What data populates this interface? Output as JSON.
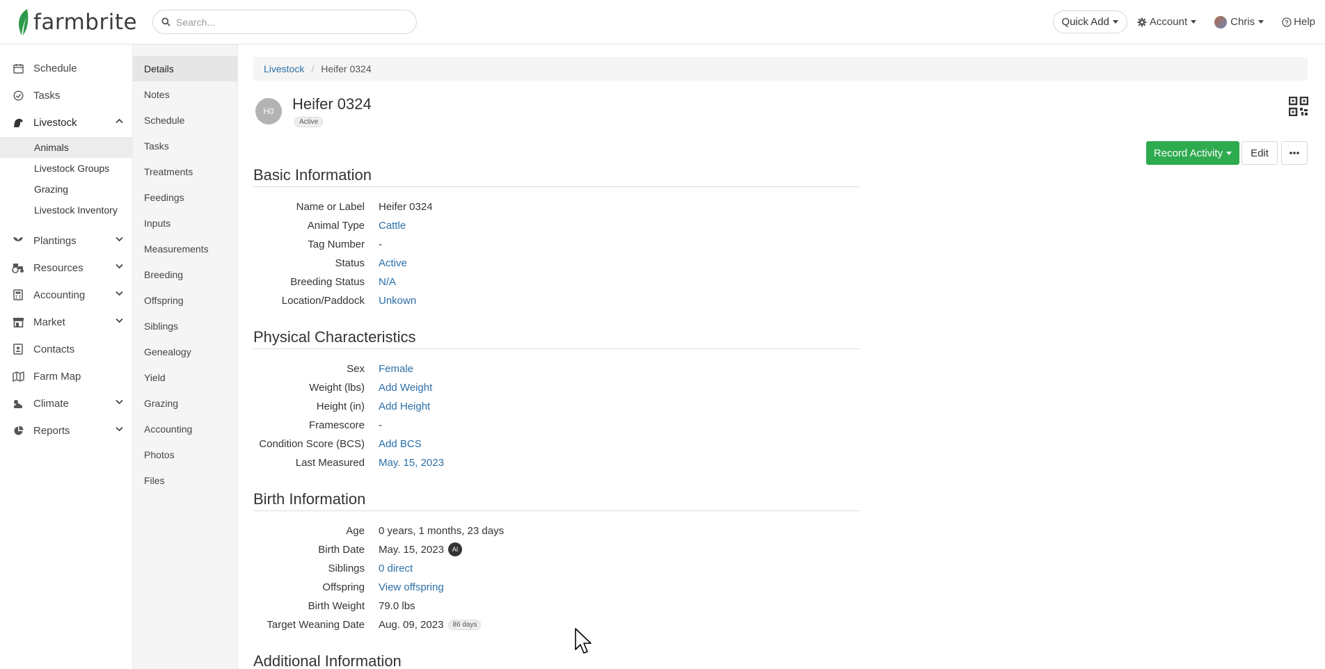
{
  "topbar": {
    "logo_text": "farmbrite",
    "search_placeholder": "Search...",
    "quick_add": "Quick Add",
    "account": "Account",
    "user": "Chris",
    "help": "Help"
  },
  "leftnav": {
    "items": [
      {
        "label": "Schedule",
        "icon": "calendar-icon"
      },
      {
        "label": "Tasks",
        "icon": "check-circle-icon"
      },
      {
        "label": "Livestock",
        "icon": "horse-icon"
      },
      {
        "label": "Plantings",
        "icon": "seedling-icon"
      },
      {
        "label": "Resources",
        "icon": "tractor-icon"
      },
      {
        "label": "Accounting",
        "icon": "calculator-icon"
      },
      {
        "label": "Market",
        "icon": "store-icon"
      },
      {
        "label": "Contacts",
        "icon": "contact-card-icon"
      },
      {
        "label": "Farm Map",
        "icon": "map-icon"
      },
      {
        "label": "Climate",
        "icon": "cloud-sun-icon"
      },
      {
        "label": "Reports",
        "icon": "pie-chart-icon"
      }
    ],
    "livestock_sub": [
      "Animals",
      "Livestock Groups",
      "Grazing",
      "Livestock Inventory"
    ]
  },
  "subnav": [
    "Details",
    "Notes",
    "Schedule",
    "Tasks",
    "Treatments",
    "Feedings",
    "Inputs",
    "Measurements",
    "Breeding",
    "Offspring",
    "Siblings",
    "Genealogy",
    "Yield",
    "Grazing",
    "Accounting",
    "Photos",
    "Files"
  ],
  "breadcrumb": {
    "parent": "Livestock",
    "current": "Heifer 0324"
  },
  "animal": {
    "initials": "H0",
    "name": "Heifer 0324",
    "status_badge": "Active"
  },
  "actions": {
    "record_activity": "Record Activity",
    "edit": "Edit"
  },
  "sections": {
    "basic": {
      "title": "Basic Information",
      "rows": [
        {
          "label": "Name or Label",
          "value": "Heifer 0324"
        },
        {
          "label": "Animal Type",
          "value": "Cattle"
        },
        {
          "label": "Tag Number",
          "value": "-"
        },
        {
          "label": "Status",
          "value": "Active"
        },
        {
          "label": "Breeding Status",
          "value": "N/A"
        },
        {
          "label": "Location/Paddock",
          "value": "Unkown"
        }
      ]
    },
    "physical": {
      "title": "Physical Characteristics",
      "rows": [
        {
          "label": "Sex",
          "value": "Female"
        },
        {
          "label": "Weight (lbs)",
          "value": "Add Weight"
        },
        {
          "label": "Height (in)",
          "value": "Add Height"
        },
        {
          "label": "Framescore",
          "value": "-"
        },
        {
          "label": "Condition Score (BCS)",
          "value": "Add BCS"
        },
        {
          "label": "Last Measured",
          "value": "May. 15, 2023"
        }
      ]
    },
    "birth": {
      "title": "Birth Information",
      "rows": [
        {
          "label": "Age",
          "value": "0 years, 1 months, 23 days"
        },
        {
          "label": "Birth Date",
          "value": "May. 15, 2023",
          "badge": "AI"
        },
        {
          "label": "Siblings",
          "value": "0 direct"
        },
        {
          "label": "Offspring",
          "value": "View offspring"
        },
        {
          "label": "Birth Weight",
          "value": "79.0 lbs"
        },
        {
          "label": "Target Weaning Date",
          "value": "Aug. 09, 2023",
          "badge": "86 days"
        }
      ]
    },
    "additional": {
      "title": "Additional Information"
    }
  },
  "colors": {
    "accent": "#2eaa4f",
    "link": "#2a6fa8",
    "logo_leaf": "#2e9a4a"
  }
}
